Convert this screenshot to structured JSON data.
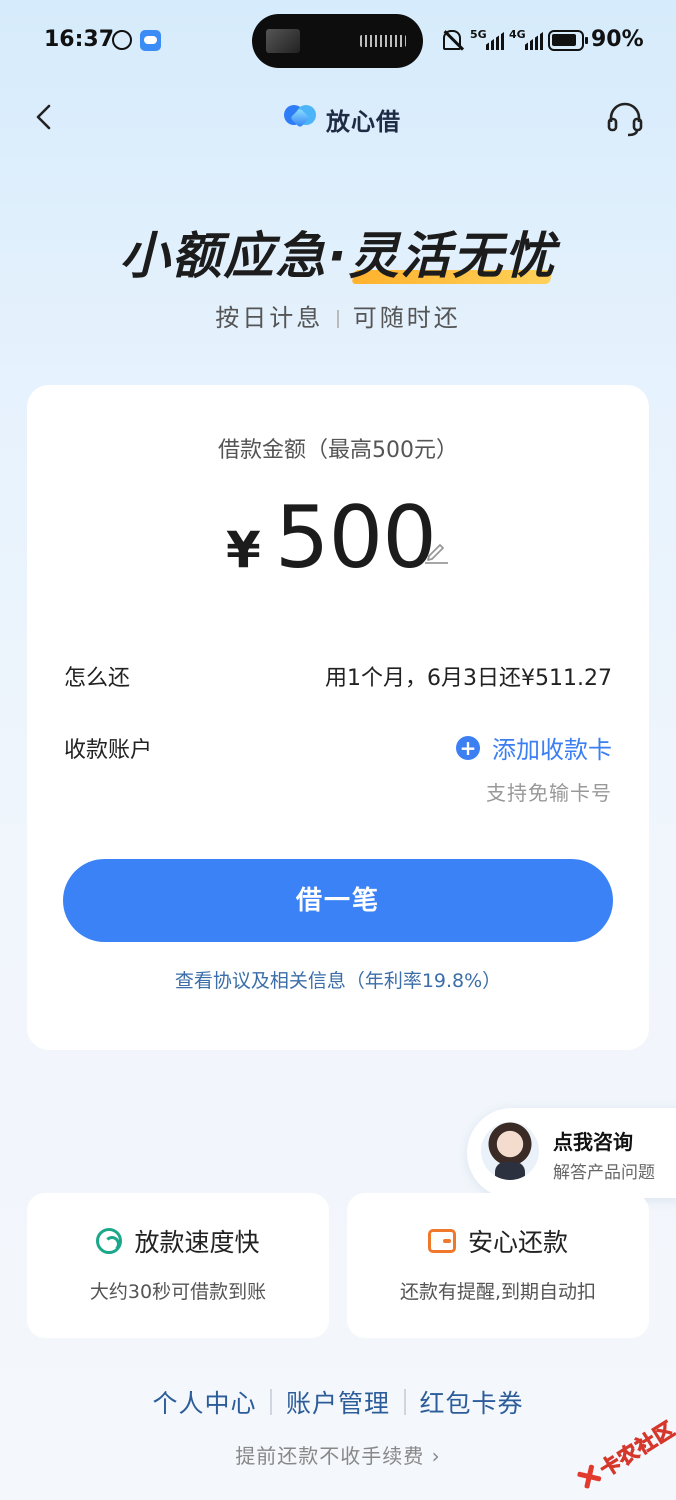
{
  "status_bar": {
    "time": "16:37",
    "network_1": "5G",
    "network_2": "4G",
    "battery": "90%"
  },
  "nav": {
    "brand": "放心借",
    "back_icon": "chevron-left-icon",
    "service_icon": "headset-icon"
  },
  "hero": {
    "title_part1": "小额应急·",
    "title_part2": "灵活无忧",
    "sub_part1": "按日计息",
    "sub_part2": "可随时还"
  },
  "loan": {
    "amount_label": "借款金额（最高500元）",
    "currency": "¥",
    "amount": "500",
    "repay_label": "怎么还",
    "repay_value": "用1个月，6月3日还¥511.27",
    "account_label": "收款账户",
    "add_card": "添加收款卡",
    "add_card_hint": "支持免输卡号",
    "borrow_button": "借一笔",
    "agreement": "查看协议及相关信息（年利率19.8%）"
  },
  "consult": {
    "title": "点我咨询",
    "subtitle": "解答产品问题"
  },
  "features": [
    {
      "title": "放款速度快",
      "desc": "大约30秒可借款到账",
      "icon": "speed-icon",
      "color": "#1ba88a"
    },
    {
      "title": "安心还款",
      "desc": "还款有提醒,到期自动扣",
      "icon": "wallet-icon",
      "color": "#f0782a"
    }
  ],
  "footer": {
    "links": [
      "个人中心",
      "账户管理",
      "红包卡券"
    ],
    "prepay_note": "提前还款不收手续费 ›"
  },
  "watermark": "卡农社区",
  "colors": {
    "primary": "#3b82f6",
    "link": "#3b6ea8",
    "accent_orange": "#ffb22e"
  }
}
